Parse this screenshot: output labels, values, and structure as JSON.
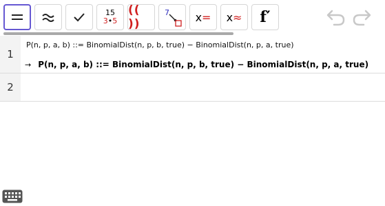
{
  "toolbar": {
    "buttons": [
      {
        "name": "evaluate-button",
        "icon": "equals-icon"
      },
      {
        "name": "numeric-button",
        "icon": "approx-icon"
      },
      {
        "name": "keep-input-button",
        "icon": "check-icon"
      },
      {
        "name": "factor-number-button",
        "top": "15",
        "bottom_left": "3",
        "bottom_mid": "•",
        "bottom_right": "5"
      },
      {
        "name": "expand-button",
        "label": "(( ))"
      },
      {
        "name": "substitute-button",
        "label": "7"
      },
      {
        "name": "solve-button",
        "x": "x",
        "op": "="
      },
      {
        "name": "nsolve-button",
        "x": "x",
        "op": "≈"
      },
      {
        "name": "derivative-button",
        "label": "f′"
      }
    ],
    "undo_icon": "undo-icon",
    "redo_icon": "redo-icon",
    "accent": "#6557d2"
  },
  "rows": [
    {
      "number": "1",
      "input": "P(n, p, a, b) ::= BinomialDist(n, p, b, true) − BinomialDist(n, p, a, true)",
      "output_arrow": "→",
      "output": "P(n, p, a, b)  ::=  BinomialDist(n, p, b, true) − BinomialDist(n, p, a, true)"
    },
    {
      "number": "2",
      "input": ""
    }
  ],
  "keyboard_icon": "keyboard-icon"
}
